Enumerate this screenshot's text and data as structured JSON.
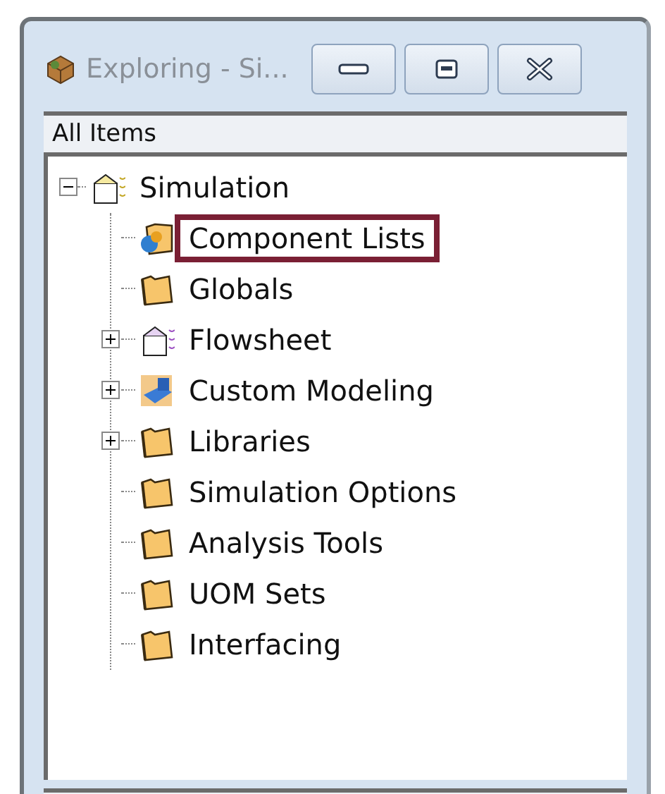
{
  "window": {
    "title": "Exploring - Si..."
  },
  "header": "All Items",
  "tree": [
    {
      "label": "Simulation",
      "kind": "simulation",
      "expanded": true,
      "selected": false,
      "children": [
        {
          "label": "Component Lists",
          "kind": "components",
          "selected": true
        },
        {
          "label": "Globals",
          "kind": "folder",
          "selected": false
        },
        {
          "label": "Flowsheet",
          "kind": "simulation",
          "expanded": false,
          "selected": false
        },
        {
          "label": "Custom Modeling",
          "kind": "modeling",
          "expanded": false,
          "selected": false
        },
        {
          "label": "Libraries",
          "kind": "folder",
          "expanded": false,
          "selected": false
        },
        {
          "label": "Simulation Options",
          "kind": "folder",
          "selected": false
        },
        {
          "label": "Analysis Tools",
          "kind": "folder",
          "selected": false
        },
        {
          "label": "UOM Sets",
          "kind": "folder",
          "selected": false
        },
        {
          "label": "Interfacing",
          "kind": "folder",
          "selected": false
        }
      ]
    }
  ]
}
